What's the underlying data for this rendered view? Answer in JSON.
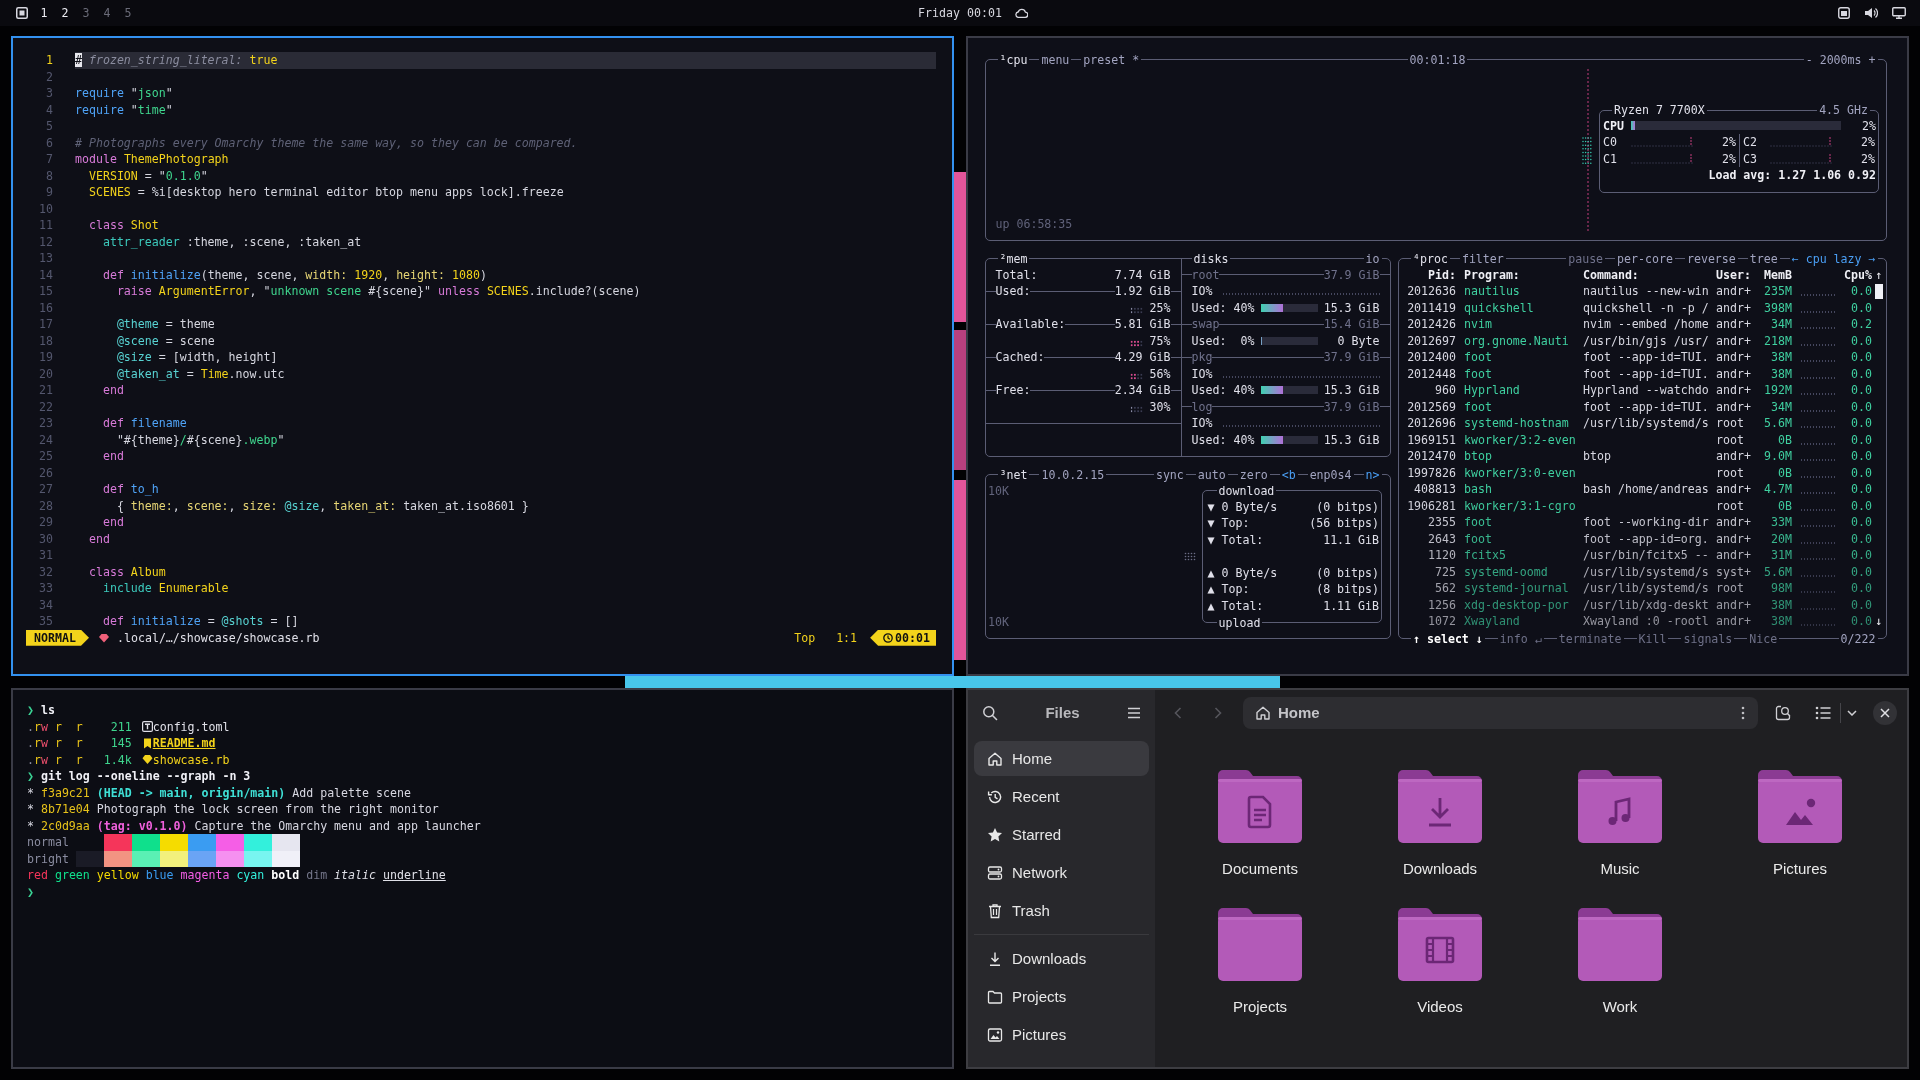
{
  "top_bar": {
    "workspaces": [
      {
        "label": "1",
        "occupied": true
      },
      {
        "label": "2",
        "occupied": true
      },
      {
        "label": "3",
        "occupied": false
      },
      {
        "label": "4",
        "occupied": false
      },
      {
        "label": "5",
        "occupied": false
      }
    ],
    "clock": "Friday 00:01"
  },
  "editor": {
    "lines": [
      {
        "number": "1",
        "current": true,
        "segments": [
          {
            "kind": "cursor",
            "text": "#"
          },
          {
            "kind": "comment",
            "text": " frozen_string_literal: "
          },
          {
            "kind": "constant",
            "text": "true"
          }
        ]
      },
      {
        "number": "2",
        "current": false
      },
      {
        "number": "3",
        "current": false,
        "segments": [
          {
            "kind": "function",
            "text": "require"
          },
          {
            "kind": "plain",
            "text": " \""
          },
          {
            "kind": "string",
            "text": "json"
          },
          {
            "kind": "plain",
            "text": "\""
          }
        ]
      },
      {
        "number": "4",
        "current": false,
        "segments": [
          {
            "kind": "function",
            "text": "require"
          },
          {
            "kind": "plain",
            "text": " \""
          },
          {
            "kind": "string",
            "text": "time"
          },
          {
            "kind": "plain",
            "text": "\""
          }
        ]
      },
      {
        "number": "5",
        "current": false
      },
      {
        "number": "6",
        "current": false,
        "segments": [
          {
            "kind": "comment",
            "text": "# Photographs every Omarchy theme the same way, so they can be compared."
          }
        ]
      },
      {
        "number": "7",
        "current": false,
        "segments": [
          {
            "kind": "keyword",
            "text": "module "
          },
          {
            "kind": "constant",
            "text": "ThemePhotograph"
          }
        ]
      },
      {
        "number": "8",
        "current": false,
        "segments": [
          {
            "kind": "constant",
            "text": "  VERSION"
          },
          {
            "kind": "plain",
            "text": " = \""
          },
          {
            "kind": "string",
            "text": "0.1.0"
          },
          {
            "kind": "plain",
            "text": "\""
          }
        ]
      },
      {
        "number": "9",
        "current": false,
        "segments": [
          {
            "kind": "constant",
            "text": "  SCENES"
          },
          {
            "kind": "plain",
            "text": " = %i[desktop hero terminal editor btop menu apps lock].freeze"
          }
        ]
      },
      {
        "number": "10",
        "current": false
      },
      {
        "number": "11",
        "current": false,
        "segments": [
          {
            "kind": "keyword",
            "text": "  class "
          },
          {
            "kind": "constant",
            "text": "Shot"
          }
        ]
      },
      {
        "number": "12",
        "current": false,
        "segments": [
          {
            "kind": "builtin",
            "text": "    attr_reader"
          },
          {
            "kind": "plain",
            "text": " :theme, :scene, :taken_at"
          }
        ]
      },
      {
        "number": "13",
        "current": false
      },
      {
        "number": "14",
        "current": false,
        "segments": [
          {
            "kind": "keyword",
            "text": "    def "
          },
          {
            "kind": "function",
            "text": "initialize"
          },
          {
            "kind": "plain",
            "text": "(theme, scene, "
          },
          {
            "kind": "label",
            "text": "width: "
          },
          {
            "kind": "number",
            "text": "1920"
          },
          {
            "kind": "plain",
            "text": ", "
          },
          {
            "kind": "label",
            "text": "height: "
          },
          {
            "kind": "number",
            "text": "1080"
          },
          {
            "kind": "plain",
            "text": ")"
          }
        ]
      },
      {
        "number": "15",
        "current": false,
        "segments": [
          {
            "kind": "keyword",
            "text": "      raise "
          },
          {
            "kind": "constant",
            "text": "ArgumentError"
          },
          {
            "kind": "plain",
            "text": ", \""
          },
          {
            "kind": "string",
            "text": "unknown scene "
          },
          {
            "kind": "plain",
            "text": "#{scene}\" "
          },
          {
            "kind": "keyword",
            "text": "unless "
          },
          {
            "kind": "constant",
            "text": "SCENES"
          },
          {
            "kind": "plain",
            "text": ".include?(scene)"
          }
        ]
      },
      {
        "number": "16",
        "current": false
      },
      {
        "number": "17",
        "current": false,
        "segments": [
          {
            "kind": "variable",
            "text": "      @theme"
          },
          {
            "kind": "plain",
            "text": " = theme"
          }
        ]
      },
      {
        "number": "18",
        "current": false,
        "segments": [
          {
            "kind": "variable",
            "text": "      @scene"
          },
          {
            "kind": "plain",
            "text": " = scene"
          }
        ]
      },
      {
        "number": "19",
        "current": false,
        "segments": [
          {
            "kind": "variable",
            "text": "      @size"
          },
          {
            "kind": "plain",
            "text": " = [width, height]"
          }
        ]
      },
      {
        "number": "20",
        "current": false,
        "segments": [
          {
            "kind": "variable",
            "text": "      @taken_at"
          },
          {
            "kind": "plain",
            "text": " = "
          },
          {
            "kind": "constant",
            "text": "Time"
          },
          {
            "kind": "plain",
            "text": ".now.utc"
          }
        ]
      },
      {
        "number": "21",
        "current": false,
        "segments": [
          {
            "kind": "keyword",
            "text": "    end"
          }
        ]
      },
      {
        "number": "22",
        "current": false
      },
      {
        "number": "23",
        "current": false,
        "segments": [
          {
            "kind": "keyword",
            "text": "    def "
          },
          {
            "kind": "function",
            "text": "filename"
          }
        ]
      },
      {
        "number": "24",
        "current": false,
        "segments": [
          {
            "kind": "plain",
            "text": "      \"#{theme}"
          },
          {
            "kind": "string",
            "text": "/"
          },
          {
            "kind": "plain",
            "text": "#{scene}"
          },
          {
            "kind": "string",
            "text": ".webp"
          },
          {
            "kind": "plain",
            "text": "\""
          }
        ]
      },
      {
        "number": "25",
        "current": false,
        "segments": [
          {
            "kind": "keyword",
            "text": "    end"
          }
        ]
      },
      {
        "number": "26",
        "current": false
      },
      {
        "number": "27",
        "current": false,
        "segments": [
          {
            "kind": "keyword",
            "text": "    def "
          },
          {
            "kind": "function",
            "text": "to_h"
          }
        ]
      },
      {
        "number": "28",
        "current": false,
        "segments": [
          {
            "kind": "plain",
            "text": "      { "
          },
          {
            "kind": "label",
            "text": "theme:"
          },
          {
            "kind": "plain",
            "text": ", "
          },
          {
            "kind": "label",
            "text": "scene:"
          },
          {
            "kind": "plain",
            "text": ", "
          },
          {
            "kind": "label",
            "text": "size: "
          },
          {
            "kind": "variable",
            "text": "@size"
          },
          {
            "kind": "plain",
            "text": ", "
          },
          {
            "kind": "label",
            "text": "taken_at:"
          },
          {
            "kind": "plain",
            "text": " taken_at.iso8601 }"
          }
        ]
      },
      {
        "number": "29",
        "current": false,
        "segments": [
          {
            "kind": "keyword",
            "text": "    end"
          }
        ]
      },
      {
        "number": "30",
        "current": false,
        "segments": [
          {
            "kind": "keyword",
            "text": "  end"
          }
        ]
      },
      {
        "number": "31",
        "current": false
      },
      {
        "number": "32",
        "current": false,
        "segments": [
          {
            "kind": "keyword",
            "text": "  class "
          },
          {
            "kind": "constant",
            "text": "Album"
          }
        ]
      },
      {
        "number": "33",
        "current": false,
        "segments": [
          {
            "kind": "builtin",
            "text": "    include "
          },
          {
            "kind": "constant",
            "text": "Enumerable"
          }
        ]
      },
      {
        "number": "34",
        "current": false
      },
      {
        "number": "35",
        "current": false,
        "segments": [
          {
            "kind": "keyword",
            "text": "    def "
          },
          {
            "kind": "function",
            "text": "initialize"
          },
          {
            "kind": "plain",
            "text": " = "
          },
          {
            "kind": "variable",
            "text": "@shots"
          },
          {
            "kind": "plain",
            "text": " = []"
          }
        ]
      }
    ],
    "status": {
      "mode": "NORMAL",
      "path": ".local/…/showcase/showcase.rb",
      "position": "Top",
      "cursor": "1:1",
      "clock": "00:01"
    }
  },
  "system_monitor": {
    "cpu": {
      "header_left": [
        {
          "text": "¹cpu",
          "kind": "title"
        },
        {
          "text": "menu",
          "kind": "option"
        },
        {
          "text": "preset *",
          "kind": "option"
        }
      ],
      "header_center": [
        {
          "text": "00:01:18",
          "kind": "option"
        }
      ],
      "header_right": [
        {
          "text": "- 2000ms +",
          "kind": "option"
        }
      ],
      "uptime": "up 06:58:35",
      "processor": {
        "model": "Ryzen 7 7700X",
        "frequency": "4.5 GHz",
        "total": {
          "label": "CPU",
          "level": 0.02,
          "reading": "2%"
        },
        "cores": [
          {
            "label": "C0",
            "reading": "2%"
          },
          {
            "label": "C2",
            "reading": "2%"
          },
          {
            "label": "C1",
            "reading": "2%"
          },
          {
            "label": "C3",
            "reading": "2%"
          }
        ],
        "load": "Load avg: 1.27 1.06 0.92"
      }
    },
    "memory": {
      "header": [
        {
          "text": "²mem",
          "kind": "title"
        }
      ],
      "total": {
        "label": "Total:",
        "value": "7.74 GiB"
      },
      "meters": [
        {
          "label": "Used:",
          "value": "1.92 GiB",
          "level": 0.25,
          "reading": "25%"
        },
        {
          "label": "Available:",
          "value": "5.81 GiB",
          "level": 0.75,
          "reading": "75%"
        },
        {
          "label": "Cached:",
          "value": "4.29 GiB",
          "level": 0.56,
          "reading": "56%"
        },
        {
          "label": "Free:",
          "value": "2.34 GiB",
          "level": 0.3,
          "reading": "30%"
        }
      ]
    },
    "disks": {
      "header_left": [
        {
          "text": "disks",
          "kind": "title"
        }
      ],
      "header_right": [
        {
          "text": "io",
          "kind": "option"
        }
      ],
      "items": [
        {
          "name": "root",
          "size": "37.9 GiB",
          "io": "IO%",
          "used_label": "Used:",
          "used": "40%",
          "level": 0.4,
          "amount": "15.3 GiB"
        },
        {
          "name": "swap",
          "size": "15.4 GiB",
          "used_label": "Used:",
          "used": "0%",
          "level": 0,
          "amount": "0 Byte"
        },
        {
          "name": "pkg",
          "size": "37.9 GiB",
          "io": "IO%",
          "used_label": "Used:",
          "used": "40%",
          "level": 0.4,
          "amount": "15.3 GiB"
        },
        {
          "name": "log",
          "size": "37.9 GiB",
          "io": "IO%",
          "used_label": "Used:",
          "used": "40%",
          "level": 0.4,
          "amount": "15.3 GiB"
        }
      ]
    },
    "network": {
      "header_left": [
        {
          "text": "³net",
          "kind": "title"
        },
        {
          "text": "10.0.2.15",
          "kind": "option"
        }
      ],
      "header_right": [
        {
          "text": "sync",
          "kind": "option"
        },
        {
          "text": "auto",
          "kind": "option"
        },
        {
          "text": "zero",
          "kind": "option"
        },
        {
          "text": "<b",
          "kind": "key"
        },
        {
          "text": "enp0s4",
          "kind": "option"
        },
        {
          "text": "n>",
          "kind": "key"
        }
      ],
      "scale_top": "10K",
      "scale_bottom": "10K",
      "download": {
        "label": "download",
        "rows": [
          {
            "name": "▼ 0 Byte/s",
            "value": "(0 bitps)"
          },
          {
            "name": "▼ Top:",
            "value": "(56 bitps)"
          },
          {
            "name": "▼ Total:",
            "value": "11.1 GiB"
          }
        ]
      },
      "upload": {
        "label": "upload",
        "rows": [
          {
            "name": "▲ 0 Byte/s",
            "value": "(0 bitps)"
          },
          {
            "name": "▲ Top:",
            "value": "(8 bitps)"
          },
          {
            "name": "▲ Total:",
            "value": "1.11 GiB"
          }
        ]
      }
    },
    "processes": {
      "header_left": [
        {
          "text": "⁴proc",
          "kind": "title"
        },
        {
          "text": "filter",
          "kind": "option"
        }
      ],
      "header_right": [
        {
          "text": "pause",
          "kind": "dim"
        },
        {
          "text": "per-core",
          "kind": "option"
        },
        {
          "text": "reverse",
          "kind": "option"
        },
        {
          "text": "tree",
          "kind": "option"
        },
        {
          "text": "← cpu lazy →",
          "kind": "key"
        }
      ],
      "columns": [
        "Pid:",
        "Program:",
        "Command:",
        "User:",
        "MemB",
        "Cpu%"
      ],
      "scroll_up": "↑",
      "scroll_down": "↓",
      "rows": [
        {
          "pid": "2012636",
          "program": "nautilus",
          "command": "nautilus --new-win",
          "user": "andr+",
          "memory": "235M",
          "cpu": "0.0"
        },
        {
          "pid": "2011419",
          "program": "quickshell",
          "command": "quickshell -n -p /",
          "user": "andr+",
          "memory": "398M",
          "cpu": "0.0"
        },
        {
          "pid": "2012426",
          "program": "nvim",
          "command": "nvim --embed /home",
          "user": "andr+",
          "memory": "34M",
          "cpu": "0.2"
        },
        {
          "pid": "2012697",
          "program": "org.gnome.Nauti",
          "command": "/usr/bin/gjs /usr/",
          "user": "andr+",
          "memory": "218M",
          "cpu": "0.0"
        },
        {
          "pid": "2012400",
          "program": "foot",
          "command": "foot --app-id=TUI.",
          "user": "andr+",
          "memory": "38M",
          "cpu": "0.0"
        },
        {
          "pid": "2012448",
          "program": "foot",
          "command": "foot --app-id=TUI.",
          "user": "andr+",
          "memory": "38M",
          "cpu": "0.0"
        },
        {
          "pid": "960",
          "program": "Hyprland",
          "command": "Hyprland --watchdo",
          "user": "andr+",
          "memory": "192M",
          "cpu": "0.0"
        },
        {
          "pid": "2012569",
          "program": "foot",
          "command": "foot --app-id=TUI.",
          "user": "andr+",
          "memory": "34M",
          "cpu": "0.0"
        },
        {
          "pid": "2012696",
          "program": "systemd-hostnam",
          "command": "/usr/lib/systemd/s",
          "user": "root",
          "memory": "5.6M",
          "cpu": "0.0"
        },
        {
          "pid": "1969151",
          "program": "kworker/3:2-even",
          "user": "root",
          "memory": "0B",
          "cpu": "0.0"
        },
        {
          "pid": "2012470",
          "program": "btop",
          "command": "btop",
          "user": "andr+",
          "memory": "9.0M",
          "cpu": "0.0"
        },
        {
          "pid": "1997826",
          "program": "kworker/3:0-even",
          "user": "root",
          "memory": "0B",
          "cpu": "0.0"
        },
        {
          "pid": "408813",
          "program": "bash",
          "command": "bash /home/andreas",
          "user": "andr+",
          "memory": "4.7M",
          "cpu": "0.0"
        },
        {
          "pid": "1906281",
          "program": "kworker/3:1-cgro",
          "user": "root",
          "memory": "0B",
          "cpu": "0.0"
        },
        {
          "pid": "2355",
          "program": "foot",
          "command": "foot --working-dir",
          "user": "andr+",
          "memory": "33M",
          "cpu": "0.0"
        },
        {
          "pid": "2643",
          "program": "foot",
          "command": "foot --app-id=org.",
          "user": "andr+",
          "memory": "20M",
          "cpu": "0.0"
        },
        {
          "pid": "1120",
          "program": "fcitx5",
          "command": "/usr/bin/fcitx5 --",
          "user": "andr+",
          "memory": "31M",
          "cpu": "0.0"
        },
        {
          "pid": "725",
          "program": "systemd-oomd",
          "command": "/usr/lib/systemd/s",
          "user": "syst+",
          "memory": "5.6M",
          "cpu": "0.0"
        },
        {
          "pid": "562",
          "program": "systemd-journal",
          "command": "/usr/lib/systemd/s",
          "user": "root",
          "memory": "98M",
          "cpu": "0.0"
        },
        {
          "pid": "1256",
          "program": "xdg-desktop-por",
          "command": "/usr/lib/xdg-deskt",
          "user": "andr+",
          "memory": "38M",
          "cpu": "0.0"
        },
        {
          "pid": "1072",
          "program": "Xwayland",
          "command": "Xwayland :0 -rootl",
          "user": "andr+",
          "memory": "38M",
          "cpu": "0.0"
        }
      ],
      "footer": [
        {
          "label": "↑ select ↓",
          "disabled": false
        },
        {
          "label": "info ↵",
          "disabled": true
        },
        {
          "label": "terminate",
          "disabled": true
        },
        {
          "label": "Kill",
          "disabled": true
        },
        {
          "label": "signals",
          "disabled": true
        },
        {
          "label": "Nice",
          "disabled": true
        }
      ],
      "count": "0/222"
    }
  },
  "terminal": {
    "lines": [
      {
        "kind": "command",
        "prompt": "❯",
        "command": "ls"
      },
      {
        "kind": "config",
        "permissions": [
          {
            "kind": "type",
            "text": "."
          },
          {
            "kind": "read",
            "text": "r"
          },
          {
            "kind": "write",
            "text": "w"
          },
          {
            "kind": "read",
            "text": " r  r"
          }
        ],
        "size": "211",
        "name": "config.toml"
      },
      {
        "kind": "markdown",
        "permissions": [
          {
            "kind": "type",
            "text": "."
          },
          {
            "kind": "read",
            "text": "r"
          },
          {
            "kind": "write",
            "text": "w"
          },
          {
            "kind": "read",
            "text": " r  r"
          }
        ],
        "size": "145",
        "name": "README.md"
      },
      {
        "kind": "ruby",
        "permissions": [
          {
            "kind": "type",
            "text": "."
          },
          {
            "kind": "read",
            "text": "r"
          },
          {
            "kind": "write",
            "text": "w"
          },
          {
            "kind": "read",
            "text": " r  r"
          }
        ],
        "size": "1.4k",
        "name": "showcase.rb"
      },
      {
        "kind": "command",
        "prompt": "❯",
        "command": "git log --oneline --graph -n 3"
      },
      {
        "kind": "commit",
        "graph": "*",
        "hash": "f3a9c21",
        "refs": "(HEAD -> main, origin/main)",
        "message": "Add palette scene"
      },
      {
        "kind": "commit",
        "graph": "*",
        "hash": "8b71e04",
        "message": "Photograph the lock screen from the right monitor"
      },
      {
        "kind": "commit",
        "graph": "*",
        "hash": "2c0d9aa",
        "tag": "(tag: v0.1.0)",
        "message": "Capture the Omarchy menu and app launcher"
      },
      {
        "kind": "palette",
        "label": "normal",
        "swatches": [
          {
            "color": "#f5355a"
          },
          {
            "color": "#0fe08c"
          },
          {
            "color": "#f5dc00"
          },
          {
            "color": "#3a9cf2"
          },
          {
            "color": "#f55ee6"
          },
          {
            "color": "#33f0dc"
          },
          {
            "color": "#e6e6f0"
          }
        ]
      },
      {
        "kind": "palette",
        "label": "bright",
        "swatches": [
          {
            "color": "#1a1b26"
          },
          {
            "color": "#f29382"
          },
          {
            "color": "#5af0b4"
          },
          {
            "color": "#f2f07c"
          },
          {
            "color": "#6aa4f5"
          },
          {
            "color": "#f590f0"
          },
          {
            "color": "#78f5f0"
          },
          {
            "color": "#f0f0f8"
          }
        ]
      },
      {
        "kind": "styles",
        "samples": [
          {
            "kind": "red",
            "text": "red"
          },
          {
            "kind": "green",
            "text": "green"
          },
          {
            "kind": "yellow",
            "text": "yellow"
          },
          {
            "kind": "blue",
            "text": "blue"
          },
          {
            "kind": "magenta",
            "text": "magenta"
          },
          {
            "kind": "cyan",
            "text": "cyan"
          },
          {
            "kind": "bold",
            "text": "bold"
          },
          {
            "kind": "dim",
            "text": "dim"
          },
          {
            "kind": "italic",
            "text": "italic"
          },
          {
            "kind": "underline",
            "text": "underline"
          }
        ]
      },
      {
        "kind": "command",
        "prompt": "❯"
      }
    ]
  },
  "files": {
    "title": "Files",
    "places": [
      {
        "kind": "home",
        "label": "Home",
        "selected": true
      },
      {
        "kind": "recent",
        "label": "Recent",
        "selected": false
      },
      {
        "kind": "starred",
        "label": "Starred",
        "selected": false
      },
      {
        "kind": "network",
        "label": "Network",
        "selected": false
      },
      {
        "kind": "trash",
        "label": "Trash",
        "selected": false
      }
    ],
    "bookmarks": [
      {
        "kind": "downloads",
        "label": "Downloads",
        "selected": false
      },
      {
        "kind": "folder",
        "label": "Projects",
        "selected": false
      },
      {
        "kind": "pictures",
        "label": "Pictures",
        "selected": false
      }
    ],
    "navigation": [
      {
        "kind": "back",
        "disabled": true
      },
      {
        "kind": "forward",
        "disabled": true
      }
    ],
    "location": "Home",
    "folders": [
      {
        "kind": "documents",
        "name": "Documents"
      },
      {
        "kind": "downloads",
        "name": "Downloads"
      },
      {
        "kind": "music",
        "name": "Music"
      },
      {
        "kind": "pictures",
        "name": "Pictures"
      },
      {
        "kind": "plain",
        "name": "Projects"
      },
      {
        "kind": "videos",
        "name": "Videos"
      },
      {
        "kind": "plain",
        "name": "Work"
      }
    ]
  }
}
